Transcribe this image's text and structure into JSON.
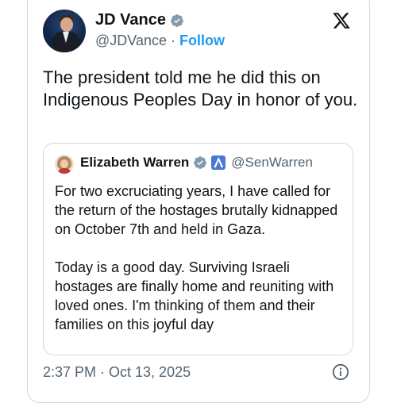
{
  "author": {
    "name": "JD Vance",
    "handle": "@JDVance",
    "separator": "·",
    "follow_label": "Follow"
  },
  "platform_icon": "x-logo-icon",
  "tweet": {
    "text": "The president told me he did this on Indigenous Peoples Day in honor of you."
  },
  "quote": {
    "name": "Elizabeth Warren",
    "handle": "@SenWarren",
    "text": "For two excruciating years, I have called for the return of the hostages brutally kidnapped on October 7th and held in Gaza.\n\nToday is a good day. Surviving Israeli hostages are finally home and reuniting with loved ones. I'm thinking of them and their families on this joyful day"
  },
  "timestamp": "2:37 PM · Oct 13, 2025",
  "colors": {
    "accent": "#1d9bf0",
    "text": "#0f1419",
    "muted": "#536471",
    "border": "#cfd9de",
    "verified": "#829aab",
    "gov_badge": "#4a78d4"
  }
}
